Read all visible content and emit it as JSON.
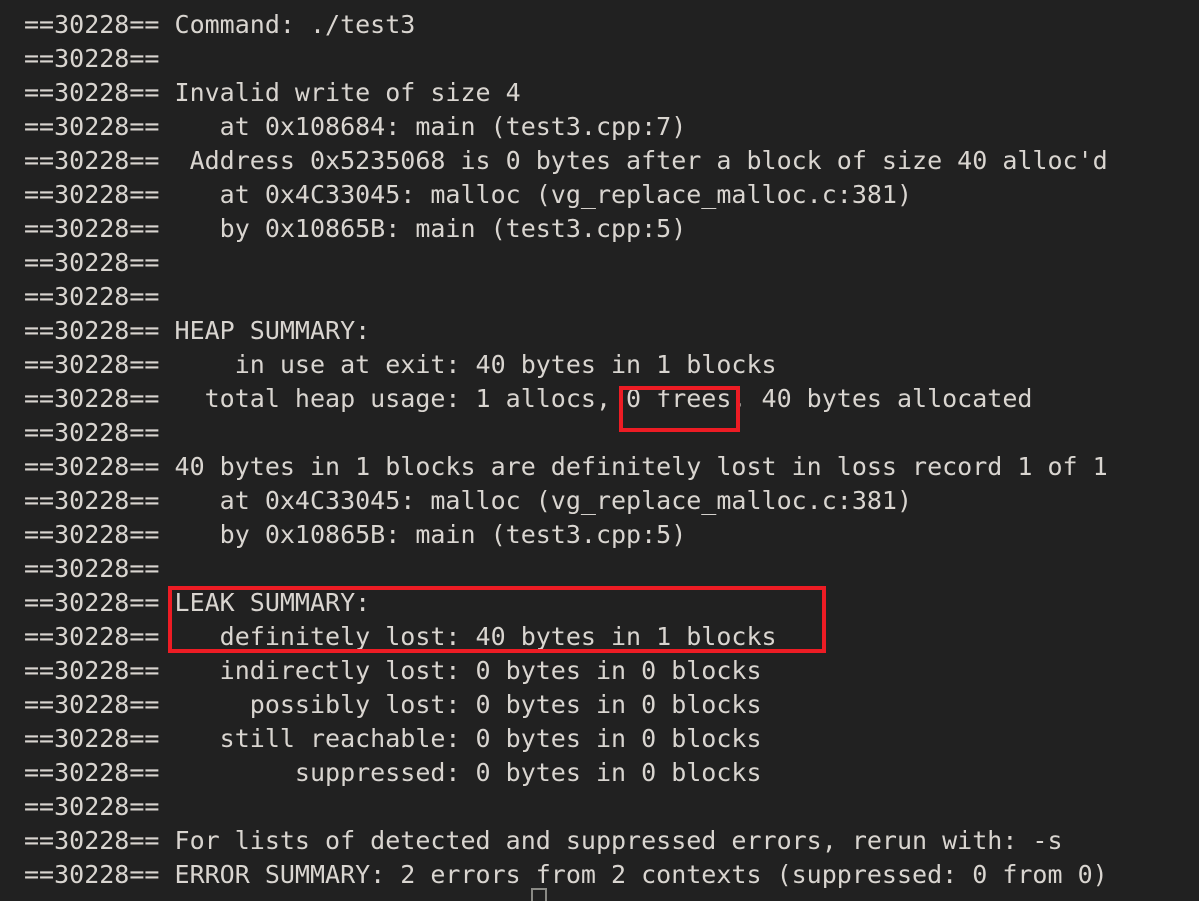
{
  "terminal": {
    "background_color": "#212121",
    "text_color": "#D9D5D0",
    "highlight_color": "#ED1C24",
    "pid_prefix": "==30228==",
    "lines": [
      "==30228== Command: ./test3",
      "==30228== ",
      "==30228== Invalid write of size 4",
      "==30228==    at 0x108684: main (test3.cpp:7)",
      "==30228==  Address 0x5235068 is 0 bytes after a block of size 40 alloc'd",
      "==30228==    at 0x4C33045: malloc (vg_replace_malloc.c:381)",
      "==30228==    by 0x10865B: main (test3.cpp:5)",
      "==30228== ",
      "==30228== ",
      "==30228== HEAP SUMMARY:",
      "==30228==     in use at exit: 40 bytes in 1 blocks",
      "==30228==   total heap usage: 1 allocs, 0 frees, 40 bytes allocated",
      "==30228== ",
      "==30228== 40 bytes in 1 blocks are definitely lost in loss record 1 of 1",
      "==30228==    at 0x4C33045: malloc (vg_replace_malloc.c:381)",
      "==30228==    by 0x10865B: main (test3.cpp:5)",
      "==30228== ",
      "==30228== LEAK SUMMARY:",
      "==30228==    definitely lost: 40 bytes in 1 blocks",
      "==30228==    indirectly lost: 0 bytes in 0 blocks",
      "==30228==      possibly lost: 0 bytes in 0 blocks",
      "==30228==    still reachable: 0 bytes in 0 blocks",
      "==30228==         suppressed: 0 bytes in 0 blocks",
      "==30228== ",
      "==30228== For lists of detected and suppressed errors, rerun with: -s",
      "==30228== ERROR SUMMARY: 2 errors from 2 contexts (suppressed: 0 from 0)"
    ]
  },
  "annotations": [
    {
      "id": "hl-frees",
      "label": "0 frees,",
      "color": "#ED1C24"
    },
    {
      "id": "hl-leak",
      "label": "LEAK SUMMARY: definitely lost: 40 bytes in 1 blocks",
      "color": "#ED1C24"
    }
  ],
  "cursor": {
    "shape": "hollow-block"
  }
}
